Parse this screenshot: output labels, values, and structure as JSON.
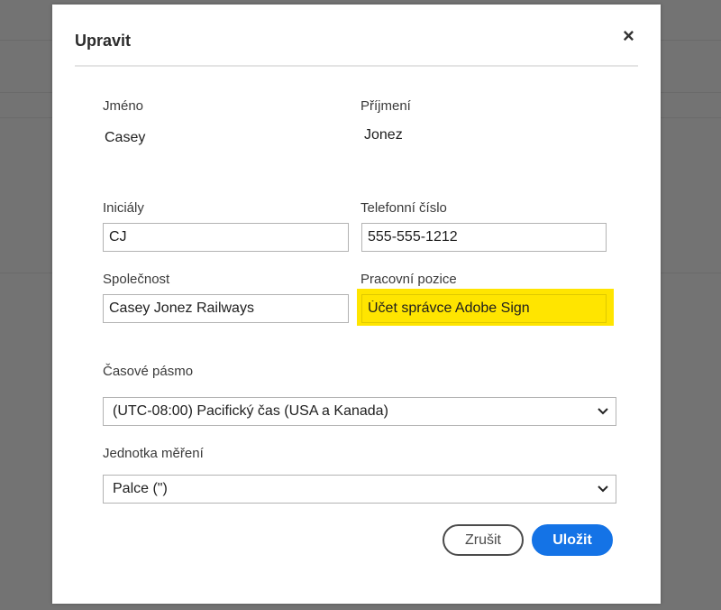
{
  "background": {
    "partial_text": "...  ...  ... "
  },
  "dialog": {
    "title": "Upravit",
    "close_glyph": "×"
  },
  "fields": {
    "first_name": {
      "label": "Jméno",
      "value": "Casey"
    },
    "last_name": {
      "label": "Příjmení",
      "value": "Jonez"
    },
    "initials": {
      "label": "Iniciály",
      "value": "CJ"
    },
    "phone": {
      "label": "Telefonní číslo",
      "value": "555-555-1212"
    },
    "company": {
      "label": "Společnost",
      "value": "Casey Jonez Railways"
    },
    "job_title": {
      "label": "Pracovní pozice",
      "value": "Účet správce Adobe Sign",
      "highlight_color": "#ffe500"
    },
    "timezone": {
      "label": "Časové pásmo",
      "value": "(UTC-08:00) Pacifický čas (USA a Kanada)"
    },
    "unit": {
      "label": "Jednotka měření",
      "value": "Palce (\")"
    }
  },
  "buttons": {
    "cancel": "Zrušit",
    "save": "Uložit"
  },
  "colors": {
    "accent": "#1473e6",
    "overlay": "#737373"
  }
}
